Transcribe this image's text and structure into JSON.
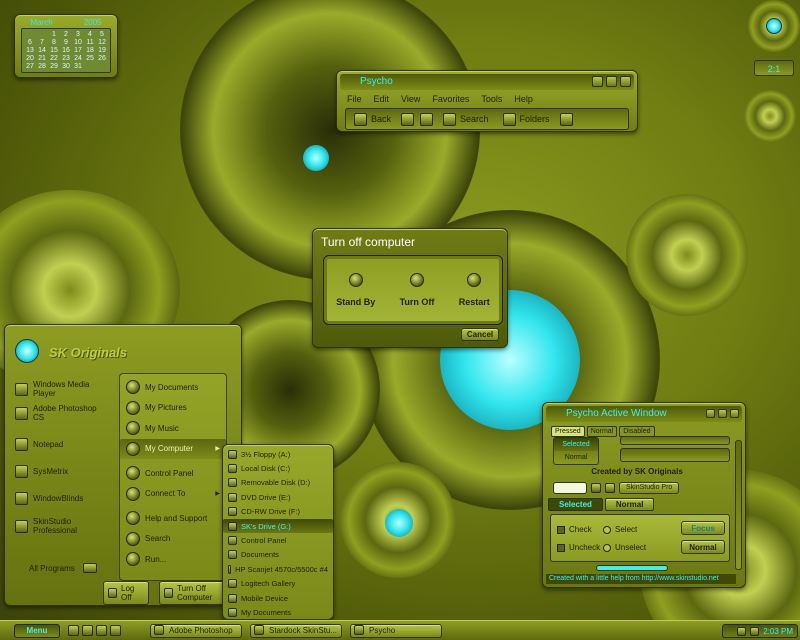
{
  "calendar": {
    "month": "March",
    "year": "2005",
    "rows": [
      [
        "",
        "",
        "1",
        "2",
        "3",
        "4",
        "5"
      ],
      [
        "6",
        "7",
        "8",
        "9",
        "10",
        "11",
        "12"
      ],
      [
        "13",
        "14",
        "15",
        "16",
        "17",
        "18",
        "19"
      ],
      [
        "20",
        "21",
        "22",
        "23",
        "24",
        "25",
        "26"
      ],
      [
        "27",
        "28",
        "29",
        "30",
        "31",
        "",
        ""
      ]
    ]
  },
  "clock": {
    "readout": "2:1"
  },
  "explorer": {
    "title": "Psycho",
    "menu": [
      "File",
      "Edit",
      "View",
      "Favorites",
      "Tools",
      "Help"
    ],
    "toolbar": {
      "back": "Back",
      "search": "Search",
      "folders": "Folders"
    }
  },
  "shutdown": {
    "title": "Turn off computer",
    "options": [
      "Stand By",
      "Turn Off",
      "Restart"
    ],
    "cancel": "Cancel"
  },
  "startmenu": {
    "title": "SK Originals",
    "pinned": [
      "Windows Media Player",
      "Adobe Photoshop CS",
      "Notepad",
      "SysMetrix",
      "WindowBlinds",
      "SkinStudio Professional"
    ],
    "places": [
      "My Documents",
      "My Pictures",
      "My Music",
      "My Computer",
      "Control Panel",
      "Connect To",
      "Help and Support",
      "Search",
      "Run..."
    ],
    "all_programs": "All Programs",
    "log_off": "Log Off",
    "turn_off": "Turn Off Computer"
  },
  "submenu": {
    "items": [
      "3½ Floppy (A:)",
      "Local Disk (C:)",
      "Removable Disk (D:)",
      "DVD Drive (E:)",
      "CD-RW Drive (F:)",
      "SK's Drive (G:)",
      "Control Panel",
      "Documents",
      "HP Scanjet 4570c/5500c #4",
      "Logitech Gallery",
      "Mobile Device",
      "My Documents"
    ],
    "active_index": 5
  },
  "skinwin": {
    "title": "Psycho  Active Window",
    "tabs": [
      "Pressed",
      "Normal",
      "Disabled"
    ],
    "state_selected": "Selected",
    "state_normal": "Normal",
    "created": "Created by SK Originals",
    "skinstudio_btn": "SkinStudio Pro",
    "tab_selected": "Selected",
    "tab_normal": "Normal",
    "check": "Check",
    "uncheck": "Uncheck",
    "select": "Select",
    "unselect": "Unselect",
    "focus_btn": "Focus",
    "normal_btn": "Normal",
    "footer": "Created with a little help from http://www.skinstudio.net"
  },
  "taskbar": {
    "start": "Menu",
    "tasks": [
      "Adobe Photoshop",
      "Stardock SkinStu...",
      "Psycho"
    ],
    "time": "2:03 PM"
  }
}
